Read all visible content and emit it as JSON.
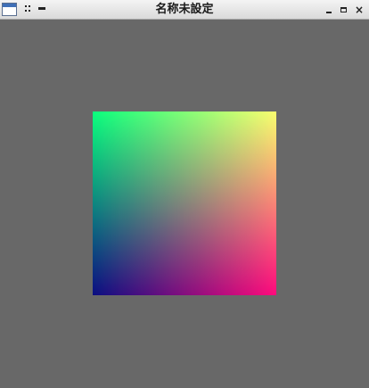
{
  "window": {
    "title": "名称未設定"
  },
  "titlebar": {
    "icons": [
      "app-icon",
      "grip-icon",
      "shade-icon"
    ],
    "buttons": {
      "minimize": "minimize-icon",
      "maximize": "maximize-icon",
      "close": "close-icon",
      "close_glyph": "×"
    }
  },
  "canvas": {
    "background": "#686868",
    "gradient_corners": {
      "top_left": "#0bff7e",
      "top_right": "#f9fe6f",
      "bottom_left": "#0b0f82",
      "bottom_right": "#ff0a7c"
    }
  }
}
